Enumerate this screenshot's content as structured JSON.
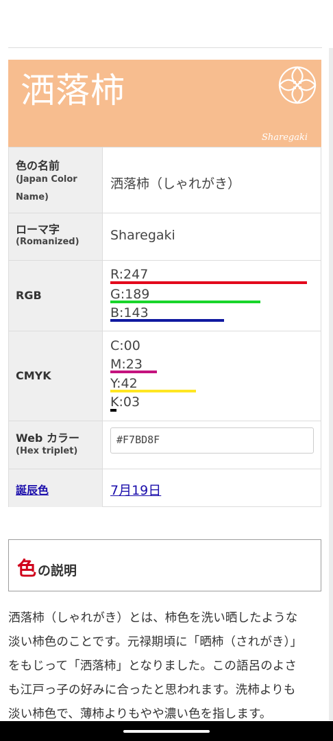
{
  "color": {
    "name_kanji": "洒落柿",
    "romanized": "Sharegaki",
    "hex_swatch": "#F7BD8F"
  },
  "table": {
    "name": {
      "label": "色の名前",
      "sub": "(Japan Color Name)",
      "value": "洒落柿（しゃれがき）"
    },
    "roman": {
      "label": "ローマ字",
      "sub": "(Romanized)",
      "value": "Sharegaki"
    },
    "rgb": {
      "label": "RGB",
      "items": [
        {
          "text": "R:247",
          "value": 247,
          "color": "#e3061b"
        },
        {
          "text": "G:189",
          "value": 189,
          "color": "#19d52b"
        },
        {
          "text": "B:143",
          "value": 143,
          "color": "#1019a0"
        }
      ]
    },
    "cmyk": {
      "label": "CMYK",
      "items": [
        {
          "text": "C:00",
          "value": 0,
          "color": "#00a3e0"
        },
        {
          "text": "M:23",
          "value": 23,
          "color": "#c4137e"
        },
        {
          "text": "Y:42",
          "value": 42,
          "color": "#ffe623"
        },
        {
          "text": "K:03",
          "value": 3,
          "color": "#000000"
        }
      ]
    },
    "web": {
      "label": "Web カラー",
      "sub": "(Hex triplet)",
      "value": "#F7BD8F"
    },
    "birthday": {
      "label": "誕辰色",
      "value": "7月19日"
    }
  },
  "description": {
    "heading_accent": "色",
    "heading_rest": "の説明",
    "lines": [
      "洒落柿（しゃれがき）とは、柿色を洗い晒したような",
      "淡い柿色のことです。元禄期頃に「晒柿（されがき）」",
      "をもじって「洒落柿」となりました。この語呂のよさ",
      "も江戸っ子の好みに合ったと思われます。洗柿よりも",
      "淡い柿色で、薄柿よりもやや濃い色を指します。"
    ]
  },
  "icons": {
    "crest": "family-crest-icon"
  }
}
